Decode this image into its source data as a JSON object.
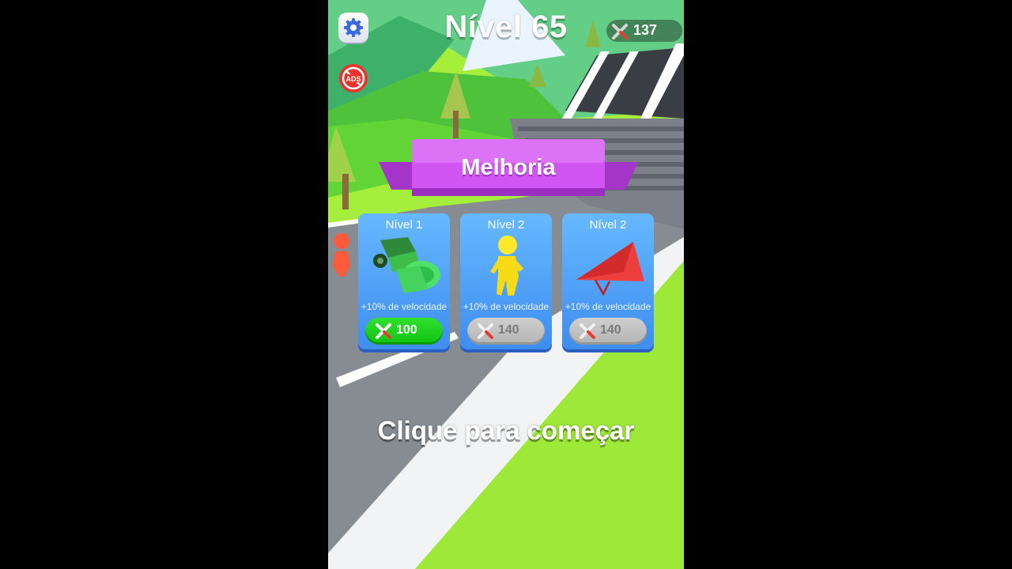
{
  "hud": {
    "level_title": "Nível 65",
    "currency": "137"
  },
  "upgrade_panel": {
    "title": "Melhoria",
    "cards": [
      {
        "level": "Nível 1",
        "description": "+10% de velocidade",
        "price": "100",
        "affordable": true,
        "item_icon": "roller-vehicle-icon"
      },
      {
        "level": "Nível 2",
        "description": "+10% de velocidade",
        "price": "140",
        "affordable": false,
        "item_icon": "runner-figure-icon"
      },
      {
        "level": "Nível 2",
        "description": "+10% de velocidade",
        "price": "140",
        "affordable": false,
        "item_icon": "hang-glider-icon"
      }
    ]
  },
  "start_prompt": "Clique para começar",
  "icons": [
    "gear-icon",
    "no-ads-icon",
    "tools-icon"
  ],
  "colors": {
    "card_blue": "#4a9cf5",
    "buy_green": "#1ed11e",
    "buy_grey": "#bdbdbd",
    "banner_purple": "#c64ee6"
  }
}
